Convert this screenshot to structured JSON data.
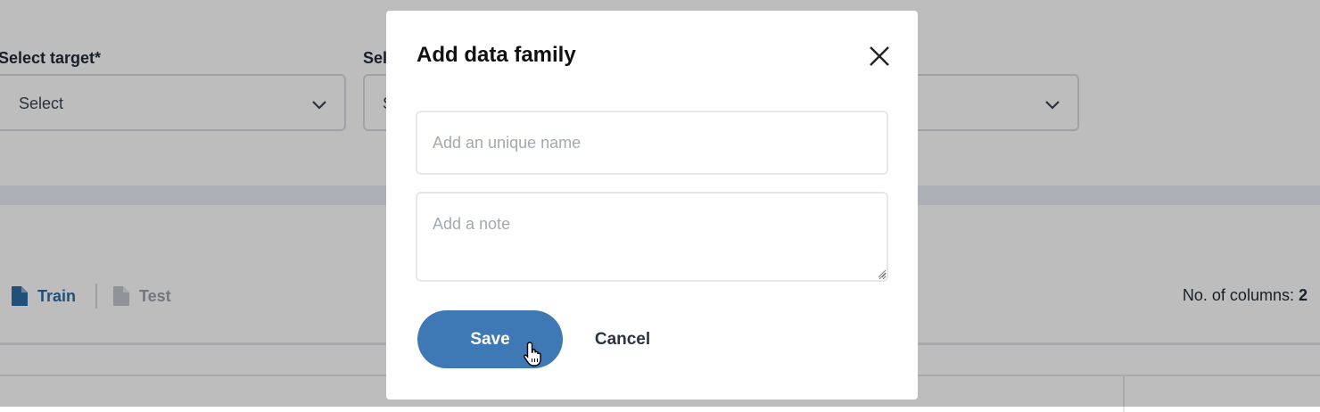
{
  "background": {
    "fields": [
      {
        "label": "Select target*",
        "value": "Select"
      },
      {
        "label": "Sel",
        "value": "S"
      },
      {
        "label": "",
        "value": ""
      }
    ],
    "tabs": [
      {
        "label": "Train",
        "icon": "file-icon",
        "active": true
      },
      {
        "label": "Test",
        "icon": "file-icon",
        "active": false
      }
    ],
    "columns": {
      "label": "No. of columns:",
      "count": "2"
    }
  },
  "modal": {
    "title": "Add data family",
    "name_placeholder": "Add an unique name",
    "note_placeholder": "Add a note",
    "save_label": "Save",
    "cancel_label": "Cancel",
    "close_icon": "close-icon"
  },
  "colors": {
    "accent": "#3f79b5",
    "tab_active": "#2d6ea6",
    "overlay": "rgba(0,0,0,0.26)"
  }
}
